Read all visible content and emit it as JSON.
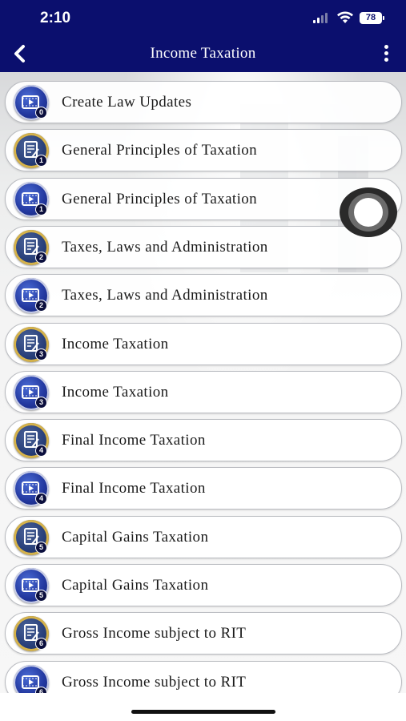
{
  "status_bar": {
    "time": "2:10",
    "battery": "78"
  },
  "nav": {
    "title": "Income Taxation",
    "back_icon": "chevron-left-icon",
    "menu_icon": "more-vertical-icon"
  },
  "items": [
    {
      "label": "Create Law Updates",
      "icon": "video-icon",
      "badge": "0"
    },
    {
      "label": "General Principles of Taxation",
      "icon": "document-icon",
      "badge": "1"
    },
    {
      "label": "General Principles of Taxation",
      "icon": "video-icon",
      "badge": "1"
    },
    {
      "label": "Taxes, Laws and Administration",
      "icon": "document-icon",
      "badge": "2"
    },
    {
      "label": "Taxes, Laws and Administration",
      "icon": "video-icon",
      "badge": "2"
    },
    {
      "label": "Income Taxation",
      "icon": "document-icon",
      "badge": "3"
    },
    {
      "label": "Income Taxation",
      "icon": "video-icon",
      "badge": "3"
    },
    {
      "label": "Final Income Taxation",
      "icon": "document-icon",
      "badge": "4"
    },
    {
      "label": "Final Income Taxation",
      "icon": "video-icon",
      "badge": "4"
    },
    {
      "label": "Capital Gains Taxation",
      "icon": "document-icon",
      "badge": "5"
    },
    {
      "label": "Capital Gains Taxation",
      "icon": "video-icon",
      "badge": "5"
    },
    {
      "label": "Gross Income subject to RIT",
      "icon": "document-icon",
      "badge": "6"
    },
    {
      "label": "Gross Income subject to RIT",
      "icon": "video-icon",
      "badge": "6"
    }
  ],
  "colors": {
    "header": "#0b0f6e",
    "icon_blue": "#23389f",
    "icon_gold_ring": "#d5b24a"
  }
}
